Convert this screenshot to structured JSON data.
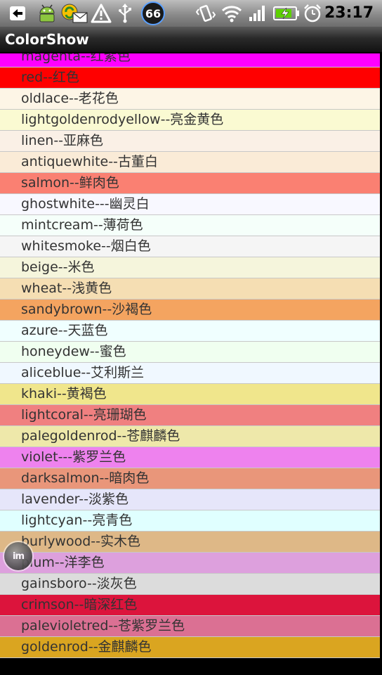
{
  "status_bar": {
    "time": "23:17",
    "notification_count": "66",
    "icons": [
      "back-arrow-icon",
      "android-debug-icon",
      "sync-mail-icon",
      "warning-icon",
      "usb-icon",
      "notification-count-icon",
      "vibrate-icon",
      "wifi-icon",
      "signal-icon",
      "battery-charging-icon",
      "alarm-icon"
    ]
  },
  "app": {
    "title": "ColorShow"
  },
  "colors": [
    {
      "label": "magenta--红紫色",
      "color": "#ff00ff"
    },
    {
      "label": "red--红色",
      "color": "#ff0000"
    },
    {
      "label": "oldlace--老花色",
      "color": "#fdf5e6"
    },
    {
      "label": "lightgoldenrodyellow--亮金黄色",
      "color": "#fafad2"
    },
    {
      "label": "linen--亚麻色",
      "color": "#faf0e6"
    },
    {
      "label": "antiquewhite--古董白",
      "color": "#faebd7"
    },
    {
      "label": "salmon--鲜肉色",
      "color": "#fa8072"
    },
    {
      "label": "ghostwhite---幽灵白",
      "color": "#f8f8ff"
    },
    {
      "label": "mintcream--薄荷色",
      "color": "#f5fffa"
    },
    {
      "label": "whitesmoke--烟白色",
      "color": "#f5f5f5"
    },
    {
      "label": "beige--米色",
      "color": "#f5f5dc"
    },
    {
      "label": "wheat--浅黄色",
      "color": "#f5deb3"
    },
    {
      "label": "sandybrown--沙褐色",
      "color": "#f4a460"
    },
    {
      "label": "azure--天蓝色",
      "color": "#f0ffff"
    },
    {
      "label": "honeydew--蜜色",
      "color": "#f0fff0"
    },
    {
      "label": "aliceblue--艾利斯兰",
      "color": "#f0f8ff"
    },
    {
      "label": "khaki--黄褐色",
      "color": "#f0e68c"
    },
    {
      "label": "lightcoral--亮珊瑚色",
      "color": "#f08080"
    },
    {
      "label": "palegoldenrod--苍麒麟色",
      "color": "#eee8aa"
    },
    {
      "label": "violet---紫罗兰色",
      "color": "#ee82ee"
    },
    {
      "label": "darksalmon--暗肉色",
      "color": "#e9967a"
    },
    {
      "label": "lavender--淡紫色",
      "color": "#e6e6fa"
    },
    {
      "label": "lightcyan--亮青色",
      "color": "#e0ffff"
    },
    {
      "label": "burlywood--实木色",
      "color": "#deb887"
    },
    {
      "label": "plum--洋李色",
      "color": "#dda0dd"
    },
    {
      "label": "gainsboro--淡灰色",
      "color": "#dcdcdc"
    },
    {
      "label": "crimson--暗深红色",
      "color": "#dc143c"
    },
    {
      "label": "palevioletred--苍紫罗兰色",
      "color": "#db7093"
    },
    {
      "label": "goldenrod--金麒麟色",
      "color": "#daa520"
    }
  ],
  "floating_button": {
    "label": "im",
    "icon": "floating-assist-icon"
  }
}
